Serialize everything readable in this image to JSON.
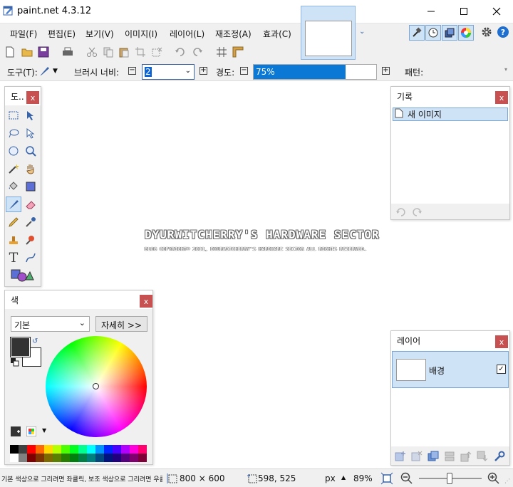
{
  "app": {
    "title": "paint.net 4.3.12"
  },
  "menu": [
    "파일(F)",
    "편집(E)",
    "보기(V)",
    "이미지(I)",
    "레이어(L)",
    "재조정(A)",
    "효과(C)"
  ],
  "options": {
    "tool_label": "도구(T):",
    "brush_width_label": "브러시 너비:",
    "brush_width_value": "2",
    "hardness_label": "경도:",
    "hardness_value": "75%",
    "hardness_fraction": 0.75,
    "fill_label": "패턴:"
  },
  "tools_panel": {
    "title": "도..",
    "close": "x"
  },
  "history_panel": {
    "title": "기록",
    "close": "x",
    "items": [
      "새 이미지"
    ]
  },
  "colors_panel": {
    "title": "색",
    "close": "x",
    "palette_select": "기본",
    "more_button": "자세히 >>",
    "primary_color": "#333333",
    "secondary_color": "#ffffff",
    "palette": [
      "#000000",
      "#404040",
      "#ff0000",
      "#ff6a00",
      "#ffd800",
      "#b6ff00",
      "#4cff00",
      "#00ff21",
      "#00ff90",
      "#00ffff",
      "#0094ff",
      "#0026ff",
      "#4800ff",
      "#b200ff",
      "#ff00dc",
      "#ff006e",
      "#ffffff",
      "#808080",
      "#7f0000",
      "#7f3300",
      "#7f6a00",
      "#5b7f00",
      "#267f00",
      "#007f0e",
      "#007f46",
      "#007f7f",
      "#004a7f",
      "#00137f",
      "#21007f",
      "#57007f",
      "#7f006e",
      "#7f0037"
    ]
  },
  "layers_panel": {
    "title": "레이어",
    "close": "x",
    "layers": [
      {
        "name": "배경",
        "visible": true
      }
    ]
  },
  "watermark": {
    "line1": "DYURWITCHERRY'S HARDWARE SECTOR",
    "line2": "BLOG COPYRIGHT© 2011, DYURWITCHERRY'S HARDWARE SECTOR ALL RIGHTS RESERVED."
  },
  "status": {
    "hint": "기본 색상으로 그리려면 좌클릭, 보조 색상으로 그리려면 우클릭...",
    "image_size": "800 × 600",
    "cursor_pos": "598, 525",
    "units": "px",
    "zoom": "89%"
  }
}
